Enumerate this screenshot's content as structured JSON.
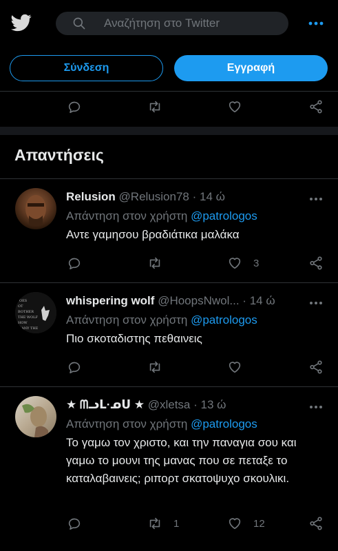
{
  "header": {
    "search_placeholder": "Αναζήτηση στο Twitter"
  },
  "auth": {
    "login_label": "Σύνδεση",
    "signup_label": "Εγγραφή"
  },
  "section_title": "Απαντήσεις",
  "tweets": [
    {
      "name": "Relusion",
      "handle": "@Relusion78",
      "time": "14 ώ",
      "reply_prefix": "Απάντηση στον χρήστη",
      "reply_mention": "@patrologos",
      "text": "Αντε γαμησου βραδιάτικα μαλάκα",
      "retweets": "",
      "likes": "3"
    },
    {
      "name": "whispering wolf",
      "handle": "@HoopsNwol...",
      "time": "14 ώ",
      "reply_prefix": "Απάντηση στον χρήστη",
      "reply_mention": "@patrologos",
      "text": "Πιο σκοταδιστης πεθαινεις",
      "retweets": "",
      "likes": ""
    },
    {
      "name": "★ ᗰᓗᒪ·ᓄᑌ ★",
      "handle": "@xletsa",
      "time": "13 ώ",
      "reply_prefix": "Απάντηση στον χρήστη",
      "reply_mention": "@patrologos",
      "text": "Το γαμω τον χριστο, και την παναγια σου και γαμω το μουνι της μανας που σε πεταξε το καταλαβαινεις; ριπορτ σκατοψυχο σκουλικι.",
      "retweets": "1",
      "likes": "12"
    }
  ],
  "colors": {
    "accent": "#1d9bf0",
    "muted": "#71767b",
    "text": "#e7e9ea"
  }
}
